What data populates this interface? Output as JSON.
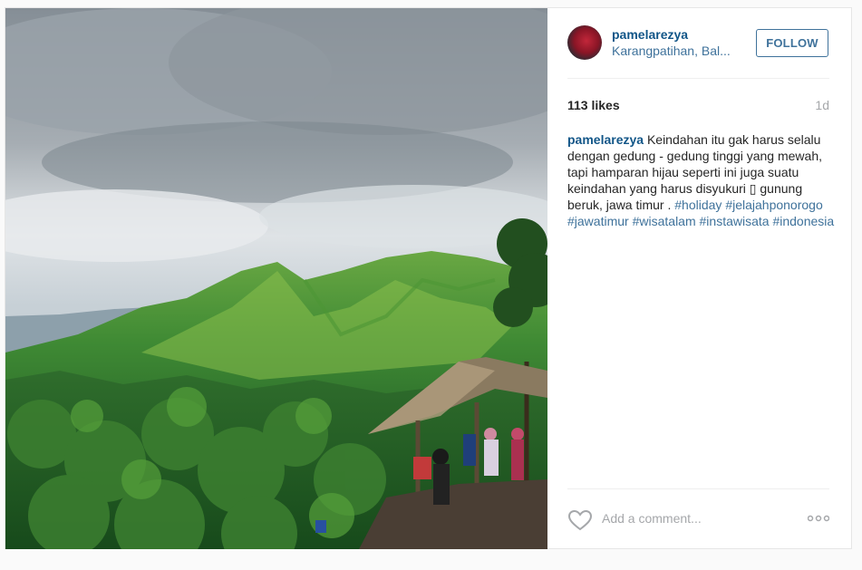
{
  "post": {
    "username": "pamelarezya",
    "location": "Karangpatihan, Bal...",
    "follow_label": "FOLLOW",
    "likes": "113 likes",
    "time": "1d",
    "caption": {
      "user": "pamelarezya",
      "text": " Keindahan itu gak harus selalu dengan gedung - gedung tinggi yang mewah, tapi hamparan hijau seperti ini juga suatu keindahan yang harus disyukuri ▯ gunung beruk, jawa timur . ",
      "tags": [
        "#holiday",
        "#jelajahponorogo",
        "#jawatimur",
        "#wisatalam",
        "#instawisata",
        "#indonesia"
      ]
    },
    "comment_placeholder": "Add a comment...",
    "icons": {
      "like": "heart-icon",
      "more": "more-options-icon"
    }
  },
  "colors": {
    "link": "#125688",
    "secondary_link": "#3f729b",
    "muted": "#a5a7aa"
  }
}
